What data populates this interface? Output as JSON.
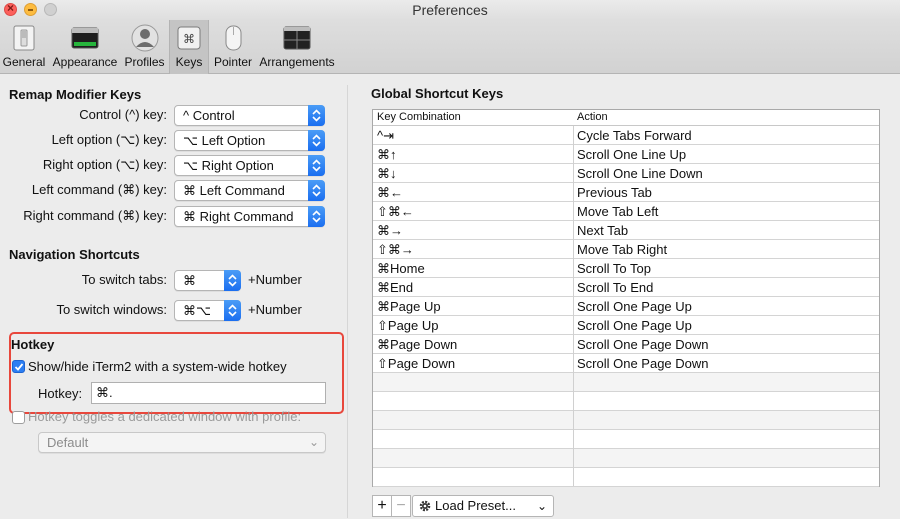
{
  "window": {
    "title": "Preferences"
  },
  "toolbar": {
    "items": [
      {
        "label": "General",
        "icon": "general-switch-icon"
      },
      {
        "label": "Appearance",
        "icon": "appearance-window-icon"
      },
      {
        "label": "Profiles",
        "icon": "profiles-person-icon"
      },
      {
        "label": "Keys",
        "icon": "keys-command-icon",
        "active": true
      },
      {
        "label": "Pointer",
        "icon": "pointer-mouse-icon"
      },
      {
        "label": "Arrangements",
        "icon": "arrangements-windows-icon"
      }
    ]
  },
  "remap": {
    "heading": "Remap Modifier Keys",
    "rows": [
      {
        "label": "Control (^) key:",
        "value": "^ Control"
      },
      {
        "label": "Left option (⌥) key:",
        "value": "⌥ Left Option"
      },
      {
        "label": "Right option (⌥) key:",
        "value": "⌥ Right Option"
      },
      {
        "label": "Left command (⌘) key:",
        "value": "⌘ Left Command"
      },
      {
        "label": "Right command (⌘) key:",
        "value": "⌘ Right Command"
      }
    ]
  },
  "navigation": {
    "heading": "Navigation Shortcuts",
    "rows": [
      {
        "label": "To switch tabs:",
        "value": "⌘",
        "suffix": "+Number"
      },
      {
        "label": "To switch windows:",
        "value": "⌘⌥",
        "suffix": "+Number"
      }
    ]
  },
  "hotkey": {
    "heading": "Hotkey",
    "show_hide_label": "Show/hide iTerm2 with a system-wide hotkey",
    "show_hide_checked": true,
    "hotkey_label": "Hotkey:",
    "hotkey_value": "⌘.",
    "dedicated_label": "Hotkey toggles a dedicated window with profile:",
    "dedicated_checked": false,
    "profile_value": "Default"
  },
  "global_shortcuts": {
    "heading": "Global Shortcut Keys",
    "columns": [
      "Key Combination",
      "Action"
    ],
    "rows": [
      [
        "^⇥",
        "Cycle Tabs Forward"
      ],
      [
        "⌘↑",
        "Scroll One Line Up"
      ],
      [
        "⌘↓",
        "Scroll One Line Down"
      ],
      [
        "⌘←",
        "Previous Tab"
      ],
      [
        "⇧⌘←",
        "Move Tab Left"
      ],
      [
        "⌘→",
        "Next Tab"
      ],
      [
        "⇧⌘→",
        "Move Tab Right"
      ],
      [
        "⌘Home",
        "Scroll To Top"
      ],
      [
        "⌘End",
        "Scroll To End"
      ],
      [
        "⌘Page Up",
        "Scroll One Page Up"
      ],
      [
        "⇧Page Up",
        "Scroll One Page Up"
      ],
      [
        "⌘Page Down",
        "Scroll One Page Down"
      ],
      [
        "⇧Page Down",
        "Scroll One Page Down"
      ]
    ],
    "add_label": "+",
    "remove_label": "−",
    "load_preset_label": "Load Preset..."
  },
  "colors": {
    "accent": "#2c7ef2",
    "highlight_frame": "#e8473c"
  }
}
